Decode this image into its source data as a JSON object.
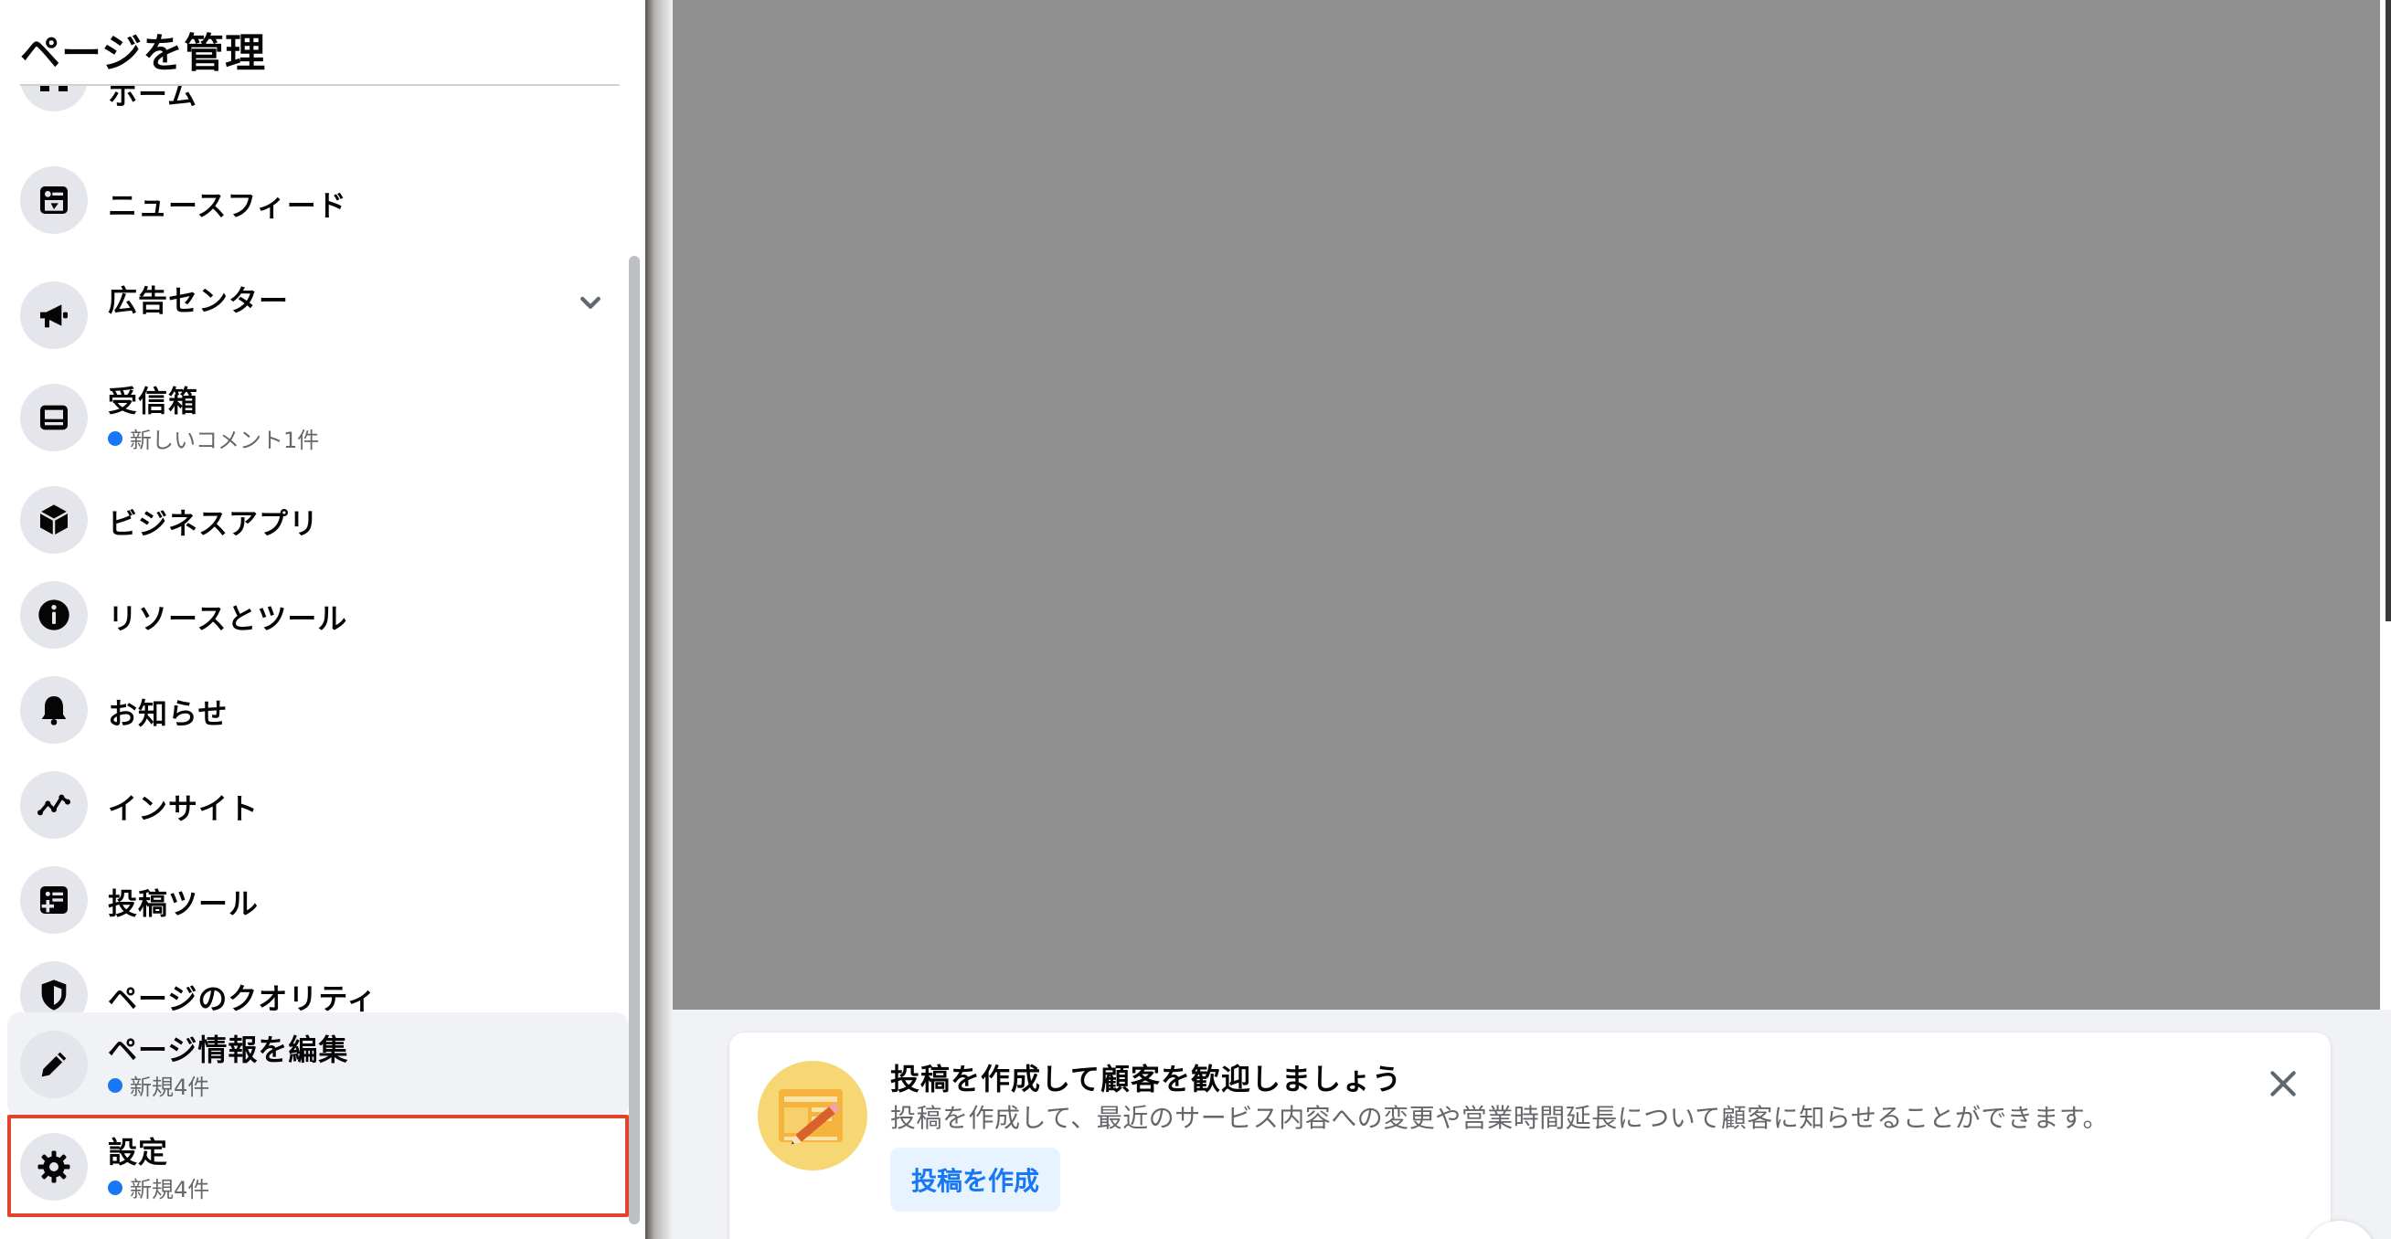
{
  "sidebar": {
    "title": "ページを管理",
    "items": [
      {
        "key": "home",
        "label": "ホーム",
        "icon": "home-icon"
      },
      {
        "key": "newsfeed",
        "label": "ニュースフィード",
        "icon": "newsfeed-icon"
      },
      {
        "key": "ads",
        "label": "広告センター",
        "icon": "megaphone-icon",
        "expandable": true
      },
      {
        "key": "inbox",
        "label": "受信箱",
        "icon": "inbox-icon",
        "sub": "新しいコメント1件"
      },
      {
        "key": "business-apps",
        "label": "ビジネスアプリ",
        "icon": "cube-icon"
      },
      {
        "key": "resources",
        "label": "リソースとツール",
        "icon": "info-icon"
      },
      {
        "key": "notifications",
        "label": "お知らせ",
        "icon": "bell-icon"
      },
      {
        "key": "insights",
        "label": "インサイト",
        "icon": "insights-icon"
      },
      {
        "key": "publishing-tools",
        "label": "投稿ツール",
        "icon": "publishing-tools-icon"
      },
      {
        "key": "page-quality",
        "label": "ページのクオリティ",
        "icon": "shield-icon"
      },
      {
        "key": "edit-page-info",
        "label": "ページ情報を編集",
        "icon": "pencil-icon",
        "sub": "新規4件"
      },
      {
        "key": "settings",
        "label": "設定",
        "icon": "gear-icon",
        "sub": "新規4件",
        "highlighted": true
      }
    ]
  },
  "promo_card": {
    "title": "投稿を作成して顧客を歓迎しましょう",
    "body": "投稿を作成して、最近のサービス内容への変更や営業時間延長について顧客に知らせることができます。",
    "button_label": "投稿を作成",
    "illustration": "pencil-post-illustration",
    "close_icon": "close-icon"
  },
  "colors": {
    "accent": "#1877f2",
    "highlight_border": "#e3432b",
    "cover": "#8f8f8f"
  }
}
